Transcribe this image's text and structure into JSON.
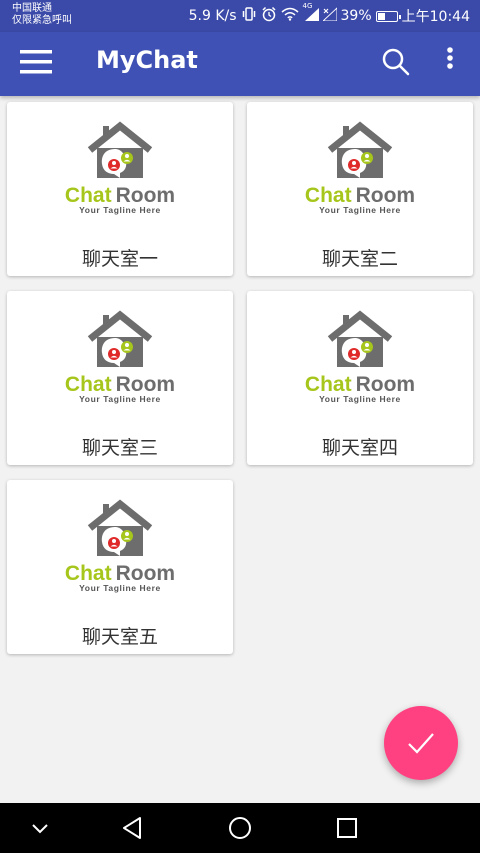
{
  "status_bar": {
    "carrier_line1": "中国联通",
    "carrier_line2": "仅限紧急呼叫",
    "network_speed": "5.9 K/s",
    "network_type": "4G",
    "battery_percent": "39%",
    "battery_level": 0.39,
    "time": "上午10:44"
  },
  "app_bar": {
    "title": "MyChat",
    "menu_icon": "hamburger-icon",
    "search_icon": "search-icon",
    "more_icon": "more-vert-icon"
  },
  "logo": {
    "title_part1": "Chat",
    "title_part2": "Room",
    "tagline": "Your Tagline Here"
  },
  "rooms": [
    {
      "label": "聊天室一"
    },
    {
      "label": "聊天室二"
    },
    {
      "label": "聊天室三"
    },
    {
      "label": "聊天室四"
    },
    {
      "label": "聊天室五"
    }
  ],
  "fab": {
    "icon": "check-icon",
    "color": "#ff4081"
  },
  "colors": {
    "primary": "#3f51b5",
    "status_bar": "#3b4aa8",
    "accent": "#ff4081",
    "logo_green": "#a6c61c"
  }
}
